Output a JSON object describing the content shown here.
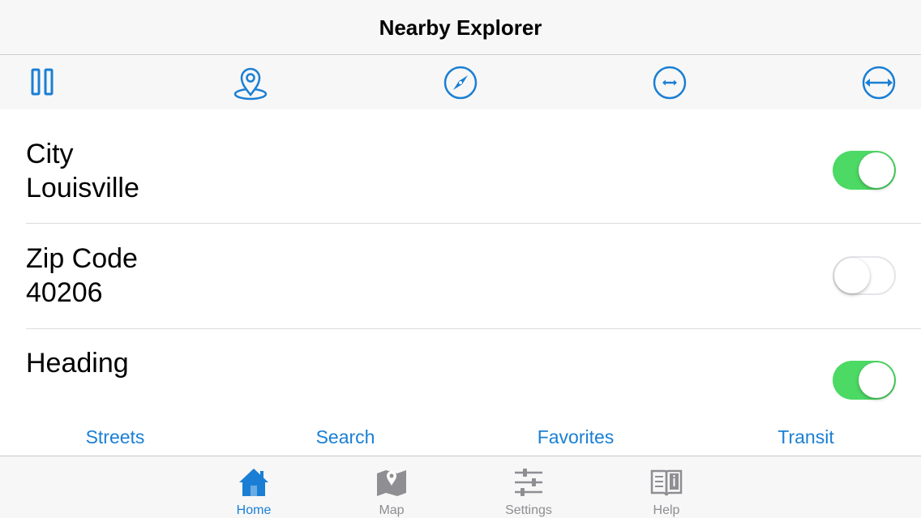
{
  "app": {
    "title": "Nearby Explorer"
  },
  "toolbar": {
    "buttons": [
      {
        "icon": "pause-icon"
      },
      {
        "icon": "location-pin-icon"
      },
      {
        "icon": "compass-icon"
      },
      {
        "icon": "narrow-range-icon"
      },
      {
        "icon": "wide-range-icon"
      }
    ],
    "accent_color": "#1a7fd4"
  },
  "rows": [
    {
      "label": "City",
      "value": "Louisville",
      "toggle_on": true
    },
    {
      "label": "Zip Code",
      "value": "40206",
      "toggle_on": false
    },
    {
      "label": "Heading",
      "value": "",
      "toggle_on": true
    }
  ],
  "quick_links": [
    "Streets",
    "Search",
    "Favorites",
    "Transit"
  ],
  "tabs": [
    {
      "label": "Home",
      "icon": "home-icon",
      "active": true
    },
    {
      "label": "Map",
      "icon": "map-icon",
      "active": false
    },
    {
      "label": "Settings",
      "icon": "sliders-icon",
      "active": false
    },
    {
      "label": "Help",
      "icon": "book-info-icon",
      "active": false
    }
  ],
  "colors": {
    "toggle_on": "#4cd964",
    "accent": "#1a7fd4",
    "inactive": "#8e8e93"
  }
}
